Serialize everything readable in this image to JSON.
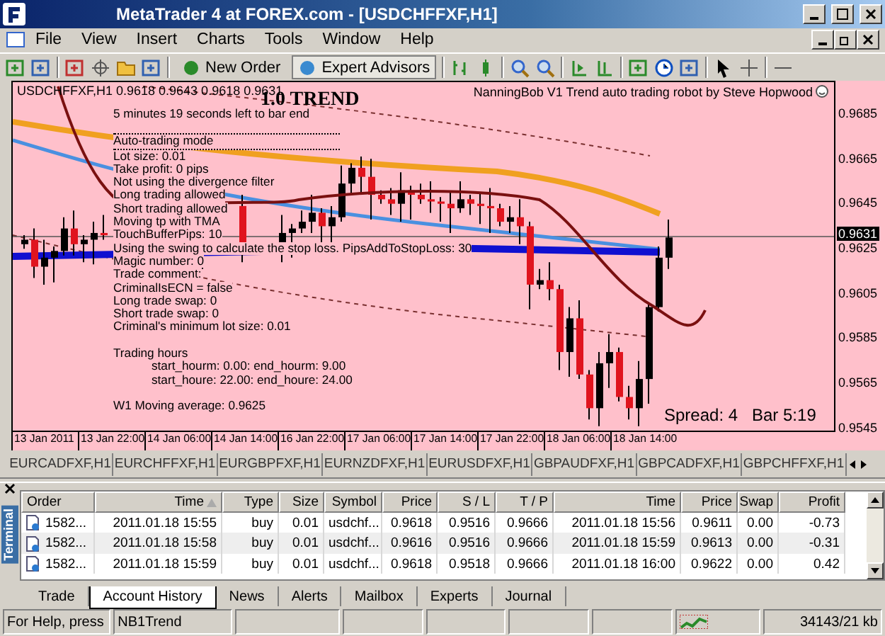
{
  "window": {
    "title": "MetaTrader 4 at FOREX.com - [USDCHFFXF,H1]"
  },
  "menu": [
    "File",
    "View",
    "Insert",
    "Charts",
    "Tools",
    "Window",
    "Help"
  ],
  "toolbar": {
    "buttons": [
      {
        "label": "New Order",
        "pressed": false
      },
      {
        "label": "Expert Advisors",
        "pressed": true
      }
    ]
  },
  "chart": {
    "header": "USDCHFFXF,H1  0.9618 0.9643 0.9618 0.9631",
    "logo": "1.0 TREND",
    "robot": "NanningBob V1 Trend auto trading robot by Steve Hopwood",
    "info": [
      {
        "kind": "plain",
        "text": "5 minutes 19 seconds left to bar end"
      },
      {
        "kind": "boxed",
        "text": "Auto-trading mode"
      },
      {
        "kind": "plain",
        "text": "Lot size: 0.01"
      },
      {
        "kind": "plain",
        "text": "Take profit: 0 pips"
      },
      {
        "kind": "plain",
        "text": "Not using the divergence filter"
      },
      {
        "kind": "plain",
        "text": "Long trading allowed"
      },
      {
        "kind": "plain",
        "text": "Short trading allowed"
      },
      {
        "kind": "plain",
        "text": "Moving tp with TMA"
      },
      {
        "kind": "plain",
        "text": "TouchBufferPips: 10"
      },
      {
        "kind": "plain",
        "text": "Using the swing to calculate the stop loss. PipsAddToStopLoss: 30"
      },
      {
        "kind": "plain",
        "text": "Magic number: 0"
      },
      {
        "kind": "plain",
        "text": "Trade comment:"
      },
      {
        "kind": "plain",
        "text": "CriminalIsECN = false"
      },
      {
        "kind": "plain",
        "text": "Long trade swap: 0"
      },
      {
        "kind": "plain",
        "text": "Short trade swap: 0"
      },
      {
        "kind": "plain",
        "text": "Criminal's minimum lot size: 0.01"
      },
      {
        "kind": "gap"
      },
      {
        "kind": "plain",
        "text": "Trading hours"
      },
      {
        "kind": "indented",
        "text": "start_hourm: 0.00: end_hourm: 9.00"
      },
      {
        "kind": "indented",
        "text": "start_houre: 22.00: end_houre: 24.00"
      },
      {
        "kind": "gap"
      },
      {
        "kind": "plain",
        "text": "W1 Moving average: 0.9625"
      }
    ],
    "spread": "Spread: 4",
    "bar": "Bar  5:19",
    "price_ticks": [
      "0.9685",
      "0.9665",
      "0.9645",
      "0.9625",
      "0.9605",
      "0.9585",
      "0.9565",
      "0.9545"
    ],
    "current_price": "0.9631",
    "time_ticks": [
      "13 Jan 2011",
      "13 Jan 22:00",
      "14 Jan 06:00",
      "14 Jan 14:00",
      "16 Jan 22:00",
      "17 Jan 06:00",
      "17 Jan 14:00",
      "17 Jan 22:00",
      "18 Jan 06:00",
      "18 Jan 14:00"
    ]
  },
  "symbol_tabs": [
    {
      "label": "EURCADFXF,H1",
      "selected": false
    },
    {
      "label": "EURCHFFXF,H1",
      "selected": false
    },
    {
      "label": "EURGBPFXF,H1",
      "selected": false
    },
    {
      "label": "EURNZDFXF,H1",
      "selected": false
    },
    {
      "label": "EURUSDFXF,H1",
      "selected": false
    },
    {
      "label": "GBPAUDFXF,H1",
      "selected": false
    },
    {
      "label": "GBPCADFXF,H1",
      "selected": false
    },
    {
      "label": "GBPCHFFXF,H1",
      "selected": false
    }
  ],
  "terminal": {
    "label": "Terminal",
    "columns": [
      "Order",
      "Time",
      "Type",
      "Size",
      "Symbol",
      "Price",
      "S / L",
      "T / P",
      "Time",
      "Price",
      "Swap",
      "Profit"
    ],
    "rows": [
      [
        "1582...",
        "2011.01.18 15:55",
        "buy",
        "0.01",
        "usdchf...",
        "0.9618",
        "0.9516",
        "0.9666",
        "2011.01.18 15:56",
        "0.9611",
        "0.00",
        "-0.73"
      ],
      [
        "1582...",
        "2011.01.18 15:58",
        "buy",
        "0.01",
        "usdchf...",
        "0.9616",
        "0.9516",
        "0.9666",
        "2011.01.18 15:59",
        "0.9613",
        "0.00",
        "-0.31"
      ],
      [
        "1582...",
        "2011.01.18 15:59",
        "buy",
        "0.01",
        "usdchf...",
        "0.9618",
        "0.9518",
        "0.9666",
        "2011.01.18 16:00",
        "0.9622",
        "0.00",
        "0.42"
      ]
    ],
    "tabs": [
      {
        "label": "Trade",
        "selected": false
      },
      {
        "label": "Account History",
        "selected": true
      },
      {
        "label": "News",
        "selected": false
      },
      {
        "label": "Alerts",
        "selected": false
      },
      {
        "label": "Mailbox",
        "selected": false
      },
      {
        "label": "Experts",
        "selected": false
      },
      {
        "label": "Journal",
        "selected": false
      }
    ]
  },
  "status_bar": {
    "help": "For Help, press",
    "profile": "NB1Trend",
    "traffic": "34143/21 kb"
  }
}
